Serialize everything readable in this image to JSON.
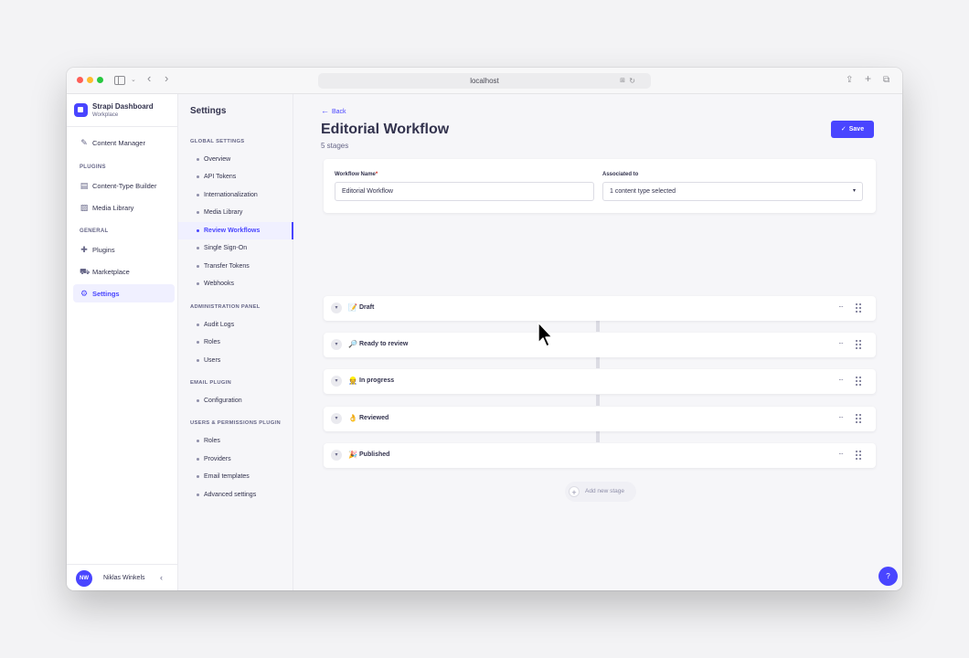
{
  "browser": {
    "url": "localhost"
  },
  "brand": {
    "name": "Strapi Dashboard",
    "workspace": "Workplace"
  },
  "main_nav": {
    "items": [
      {
        "label": "Content Manager",
        "icon": "pencil-icon"
      }
    ],
    "sections": [
      {
        "title": "PLUGINS",
        "items": [
          {
            "label": "Content-Type Builder",
            "icon": "layout-icon"
          },
          {
            "label": "Media Library",
            "icon": "image-icon"
          }
        ]
      },
      {
        "title": "GENERAL",
        "items": [
          {
            "label": "Plugins",
            "icon": "puzzle-icon"
          },
          {
            "label": "Marketplace",
            "icon": "cart-icon"
          },
          {
            "label": "Settings",
            "icon": "gear-icon",
            "active": true
          }
        ]
      }
    ],
    "user": {
      "initials": "NW",
      "name": "Niklas Winkels"
    }
  },
  "settings_nav": {
    "title": "Settings",
    "sections": [
      {
        "title": "GLOBAL SETTINGS",
        "items": [
          "Overview",
          "API Tokens",
          "Internationalization",
          "Media Library",
          "Review Workflows",
          "Single Sign-On",
          "Transfer Tokens",
          "Webhooks"
        ]
      },
      {
        "title": "ADMINISTRATION PANEL",
        "items": [
          "Audit Logs",
          "Roles",
          "Users"
        ]
      },
      {
        "title": "EMAIL PLUGIN",
        "items": [
          "Configuration"
        ]
      },
      {
        "title": "USERS & PERMISSIONS PLUGIN",
        "items": [
          "Roles",
          "Providers",
          "Email templates",
          "Advanced settings"
        ]
      }
    ],
    "active_item": "Review Workflows"
  },
  "page": {
    "back_label": "Back",
    "title": "Editorial Workflow",
    "subtitle": "5 stages",
    "save_label": "Save",
    "form": {
      "name_label": "Workflow Name",
      "name_value": "Editorial Workflow",
      "associated_label": "Associated to",
      "associated_value": "1 content type selected"
    },
    "stages": [
      {
        "emoji": "📝",
        "name": "Draft"
      },
      {
        "emoji": "🔎",
        "name": "Ready to review"
      },
      {
        "emoji": "👷",
        "name": "In progress"
      },
      {
        "emoji": "👌",
        "name": "Reviewed"
      },
      {
        "emoji": "🎉",
        "name": "Published"
      }
    ],
    "add_stage_label": "Add new stage",
    "help_label": "?"
  },
  "colors": {
    "accent": "#4945ff",
    "active_bg": "#f0f0ff"
  }
}
